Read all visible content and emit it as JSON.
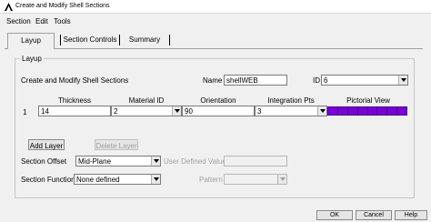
{
  "window": {
    "title": "Create and Modify Shell Sections"
  },
  "menu": [
    "Section",
    "Edit",
    "Tools"
  ],
  "tabs": [
    {
      "label": "Layup",
      "active": true
    },
    {
      "label": "Section Controls",
      "active": false
    },
    {
      "label": "Summary",
      "active": false
    }
  ],
  "layup": {
    "group_title": "Layup",
    "heading": "Create and Modify Shell Sections",
    "name_label": "Name",
    "name_value": "shellWEB",
    "id_label": "ID",
    "id_value": "6",
    "columns": [
      "Thickness",
      "Material ID",
      "Orientation",
      "Integration Pts",
      "Pictorial View"
    ],
    "rows": [
      {
        "index": "1",
        "thickness": "14",
        "material_id": "2",
        "orientation": "90",
        "integration_pts": "3"
      }
    ],
    "add_layer_label": "Add Layer",
    "delete_layer_label": "Delete Layer",
    "section_offset_label": "Section Offset",
    "section_offset_value": "Mid-Plane",
    "user_defined_value_label": "User Defined Value",
    "user_defined_value": "",
    "section_function_label": "Section Function",
    "section_function_value": "None defined",
    "pattern_label": "Pattern",
    "pattern_value": ""
  },
  "footer": {
    "ok_label": "OK",
    "cancel_label": "Cancel",
    "help_label": "Help"
  },
  "colors": {
    "pictorial_fill": "#7a00d8"
  }
}
